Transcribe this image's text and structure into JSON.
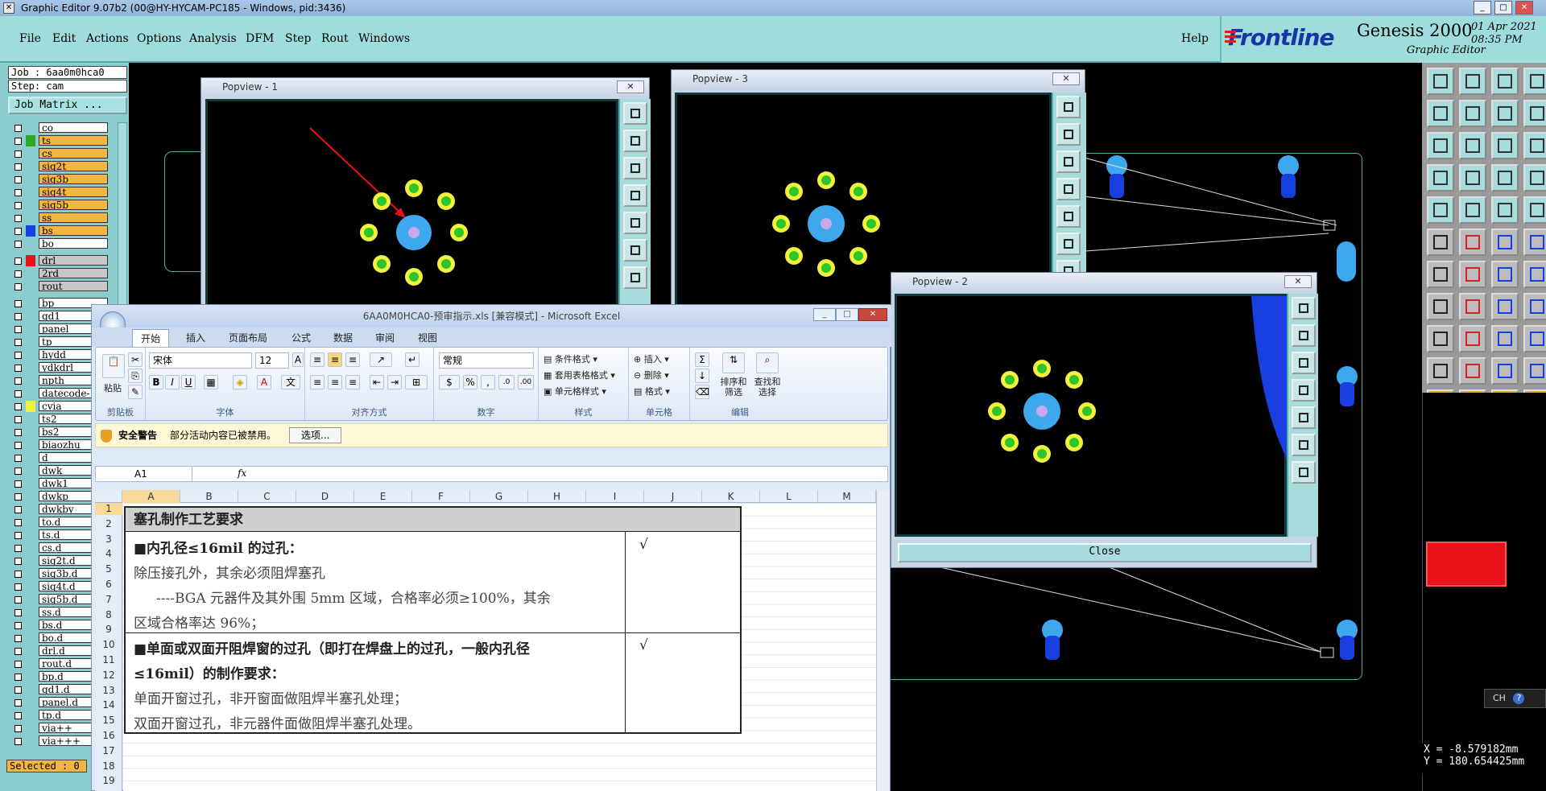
{
  "window": {
    "title": "Graphic Editor 9.07b2 (00@HY-HYCAM-PC185 - Windows, pid:3436)"
  },
  "menu": {
    "items": [
      "File",
      "Edit",
      "Actions",
      "Options",
      "Analysis",
      "DFM",
      "Step",
      "Rout",
      "Windows"
    ],
    "help": "Help"
  },
  "logo": {
    "brand": "Frontline",
    "product": "Genesis 2000",
    "subtitle": "Graphic Editor",
    "date": "01 Apr 2021",
    "time": "08:35 PM"
  },
  "job": {
    "job_label": "Job : 6aa0m0hca0",
    "step_label": "Step: cam",
    "matrix_button": "Job Matrix ..."
  },
  "layers_top": [
    {
      "name": "co",
      "color": "",
      "style": "white"
    },
    {
      "name": "ts",
      "color": "#2da82d",
      "style": "orange"
    },
    {
      "name": "cs",
      "color": "",
      "style": "orange"
    },
    {
      "name": "sig2t",
      "color": "",
      "style": "orange"
    },
    {
      "name": "sig3b",
      "color": "",
      "style": "orange"
    },
    {
      "name": "sig4t",
      "color": "",
      "style": "orange"
    },
    {
      "name": "sig5b",
      "color": "",
      "style": "orange"
    },
    {
      "name": "ss",
      "color": "",
      "style": "orange"
    },
    {
      "name": "bs",
      "color": "#1a3fe0",
      "style": "orange"
    },
    {
      "name": "bo",
      "color": "",
      "style": "white"
    }
  ],
  "layers_drill": [
    {
      "name": "drl",
      "color": "#e8111a",
      "style": "gray"
    },
    {
      "name": "2rd",
      "color": "",
      "style": "gray"
    },
    {
      "name": "rout",
      "color": "",
      "style": "gray"
    }
  ],
  "layers_misc": [
    {
      "name": "bp",
      "color": "",
      "style": "white"
    },
    {
      "name": "gd1",
      "color": "",
      "style": "white"
    },
    {
      "name": "panel",
      "color": "",
      "style": "white"
    },
    {
      "name": "tp",
      "color": "",
      "style": "white"
    },
    {
      "name": "hydd",
      "color": "",
      "style": "white"
    },
    {
      "name": "ydkdrl",
      "color": "",
      "style": "white"
    },
    {
      "name": "npth",
      "color": "",
      "style": "white"
    },
    {
      "name": "datecode-",
      "color": "",
      "style": "white"
    },
    {
      "name": "cvia",
      "color": "#f2f23a",
      "style": "white"
    },
    {
      "name": "ts2",
      "color": "",
      "style": "white"
    },
    {
      "name": "bs2",
      "color": "",
      "style": "white"
    },
    {
      "name": "biaozhu",
      "color": "",
      "style": "white"
    },
    {
      "name": "d",
      "color": "",
      "style": "white"
    },
    {
      "name": "dwk",
      "color": "",
      "style": "white"
    },
    {
      "name": "dwk1",
      "color": "",
      "style": "white"
    },
    {
      "name": "dwkp",
      "color": "",
      "style": "white"
    },
    {
      "name": "dwkby",
      "color": "",
      "style": "white"
    },
    {
      "name": "to.d",
      "color": "",
      "style": "white"
    },
    {
      "name": "ts.d",
      "color": "",
      "style": "white"
    },
    {
      "name": "cs.d",
      "color": "",
      "style": "white"
    },
    {
      "name": "sig2t.d",
      "color": "",
      "style": "white"
    },
    {
      "name": "sig3b.d",
      "color": "",
      "style": "white"
    },
    {
      "name": "sig4t.d",
      "color": "",
      "style": "white"
    },
    {
      "name": "sig5b.d",
      "color": "",
      "style": "white"
    },
    {
      "name": "ss.d",
      "color": "",
      "style": "white"
    },
    {
      "name": "bs.d",
      "color": "",
      "style": "white"
    },
    {
      "name": "bo.d",
      "color": "",
      "style": "white"
    },
    {
      "name": "drl.d",
      "color": "",
      "style": "white"
    },
    {
      "name": "rout.d",
      "color": "",
      "style": "white"
    },
    {
      "name": "bp.d",
      "color": "",
      "style": "white"
    },
    {
      "name": "gd1.d",
      "color": "",
      "style": "white"
    },
    {
      "name": "panel.d",
      "color": "",
      "style": "white"
    },
    {
      "name": "tp.d",
      "color": "",
      "style": "white"
    },
    {
      "name": "via++",
      "color": "",
      "style": "white"
    },
    {
      "name": "via+++",
      "color": "",
      "style": "white"
    }
  ],
  "status": {
    "selected": "Selected : 0",
    "coord_x": "X = -8.579182mm",
    "coord_y": "Y = 180.654425mm",
    "input_method": "CH"
  },
  "popviews": {
    "p1": "Popview - 1",
    "p2": "Popview - 2",
    "p3": "Popview - 3",
    "close": "Close"
  },
  "excel": {
    "title": "6AA0M0HCA0-预审指示.xls [兼容模式] - Microsoft Excel",
    "tabs": [
      "开始",
      "插入",
      "页面布局",
      "公式",
      "数据",
      "审阅",
      "视图"
    ],
    "font_name": "宋体",
    "font_size": "12",
    "number_format": "常规",
    "groups": [
      "剪贴板",
      "字体",
      "对齐方式",
      "数字",
      "样式",
      "单元格",
      "编辑"
    ],
    "paste": "粘贴",
    "cond_format": "条件格式",
    "table_format": "套用表格格式",
    "cell_style": "单元格样式",
    "insert": "插入",
    "delete": "删除",
    "format": "格式",
    "sort_filter": "排序和筛选",
    "find_select": "查找和选择",
    "security_title": "安全警告",
    "security_msg": "部分活动内容已被禁用。",
    "options_btn": "选项...",
    "name_box": "A1",
    "fx": "fx",
    "columns": [
      "A",
      "B",
      "C",
      "D",
      "E",
      "F",
      "G",
      "H",
      "I",
      "J",
      "K",
      "L",
      "M"
    ],
    "rows": [
      "1",
      "2",
      "3",
      "4",
      "5",
      "6",
      "7",
      "8",
      "9",
      "10",
      "11",
      "12",
      "13",
      "14",
      "15",
      "16",
      "17",
      "18",
      "19"
    ],
    "content": {
      "header": "塞孔制作工艺要求",
      "s1_title": "■内孔径≤16mil 的过孔：",
      "s1_line1": "除压接孔外，其余必须阻焊塞孔",
      "s1_line2": "----BGA 元器件及其外围 5mm 区域，合格率必须≥100%，其余",
      "s1_line3": "区域合格率达 96%；",
      "s1_check": "√",
      "s2_title": "■单面或双面开阻焊窗的过孔（即打在焊盘上的过孔，一般内孔径",
      "s2_title2": "≤16mil）的制作要求：",
      "s2_line1": "单面开窗过孔，非开窗面做阻焊半塞孔处理；",
      "s2_line2": "双面开窗过孔，非元器件面做阻焊半塞孔处理。",
      "s2_check": "√"
    }
  },
  "colors": {
    "cyan_panel": "#8ccccc",
    "pad_yellow": "#f2f23a",
    "pad_green": "#2ec42e",
    "pad_blue": "#3ea8ee",
    "pad_lavender": "#c8a8e8",
    "arrow_red": "#e8111a"
  }
}
